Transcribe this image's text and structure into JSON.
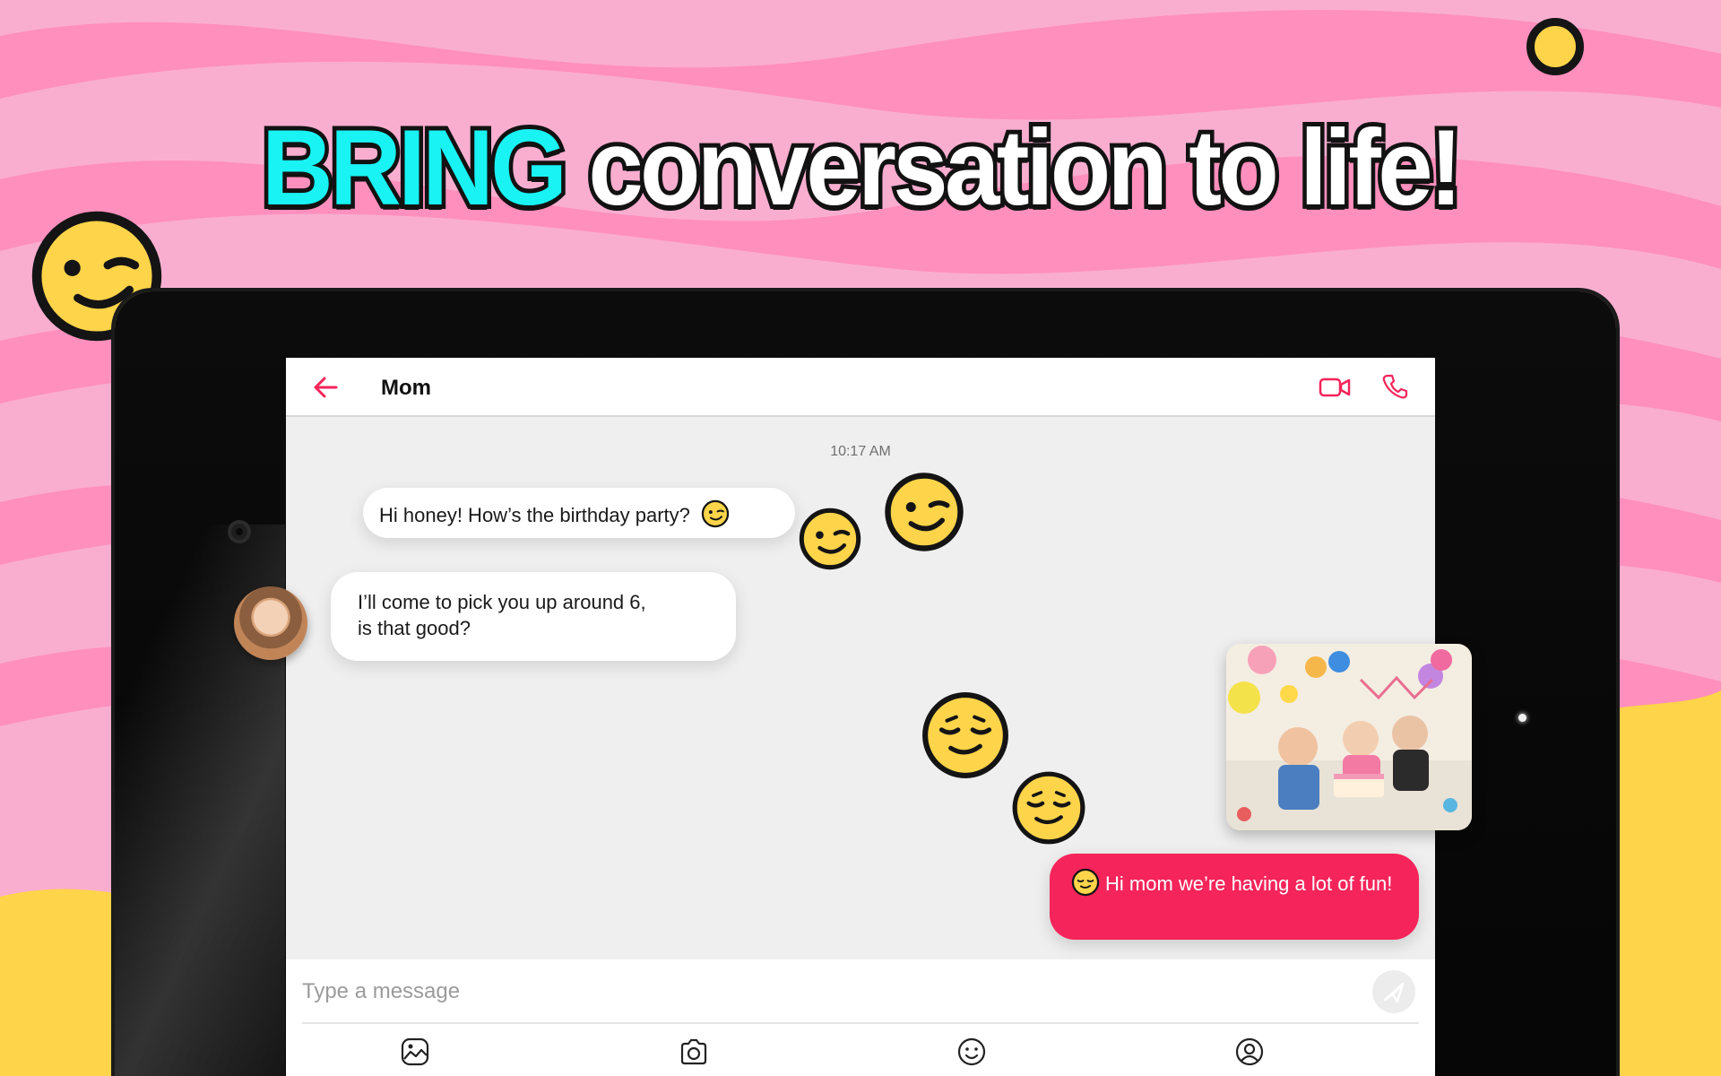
{
  "headline": {
    "accent": "BRING",
    "rest": "conversation to life!"
  },
  "colors": {
    "accent": "#f5245a",
    "headline_accent": "#19f3f3",
    "background": "#f9a6cc",
    "emoji_yellow": "#fdd44a"
  },
  "chat": {
    "contact_name": "Mom",
    "timestamp": "10:17 AM",
    "messages": [
      {
        "from": "other",
        "text": "Hi honey! How’s the birthday party?",
        "emoji": "wink-emoji"
      },
      {
        "from": "other",
        "text_line1": "I’ll come to pick you up around 6,",
        "text_line2": "is that good?"
      },
      {
        "from": "me",
        "text": "Hi mom we’re having a lot of fun!",
        "emoji": "relieved-emoji"
      }
    ],
    "shared_image": "birthday-party-photo"
  },
  "composer": {
    "placeholder": "Type a message",
    "toolbar": [
      "gallery-icon",
      "camera-icon",
      "emoji-icon",
      "contacts-icon"
    ]
  },
  "icons": {
    "back": "arrow-left-icon",
    "video": "video-call-icon",
    "phone": "phone-icon",
    "send": "send-icon"
  }
}
